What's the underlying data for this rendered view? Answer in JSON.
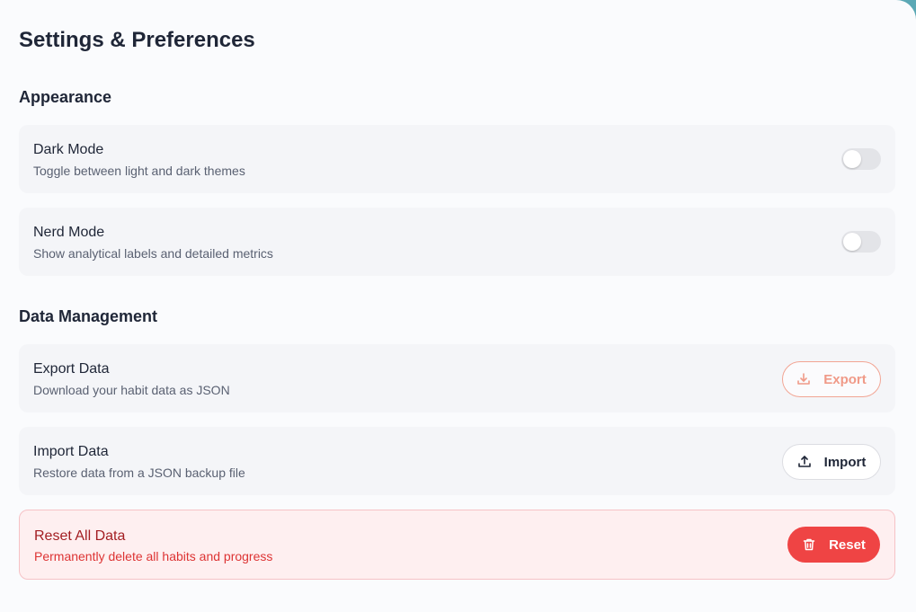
{
  "page": {
    "title": "Settings & Preferences"
  },
  "appearance": {
    "heading": "Appearance",
    "dark_mode": {
      "title": "Dark Mode",
      "description": "Toggle between light and dark themes",
      "enabled": false
    },
    "nerd_mode": {
      "title": "Nerd Mode",
      "description": "Show analytical labels and detailed metrics",
      "enabled": false
    }
  },
  "data_management": {
    "heading": "Data Management",
    "export": {
      "title": "Export Data",
      "description": "Download your habit data as JSON",
      "button_label": "Export",
      "icon": "download-icon"
    },
    "import": {
      "title": "Import Data",
      "description": "Restore data from a JSON backup file",
      "button_label": "Import",
      "icon": "upload-icon"
    },
    "reset": {
      "title": "Reset All Data",
      "description": "Permanently delete all habits and progress",
      "button_label": "Reset",
      "icon": "trash-icon"
    }
  },
  "colors": {
    "danger": "#ef4444",
    "export_accent": "#f09a88",
    "toggle_off": "#e3e4e8"
  }
}
